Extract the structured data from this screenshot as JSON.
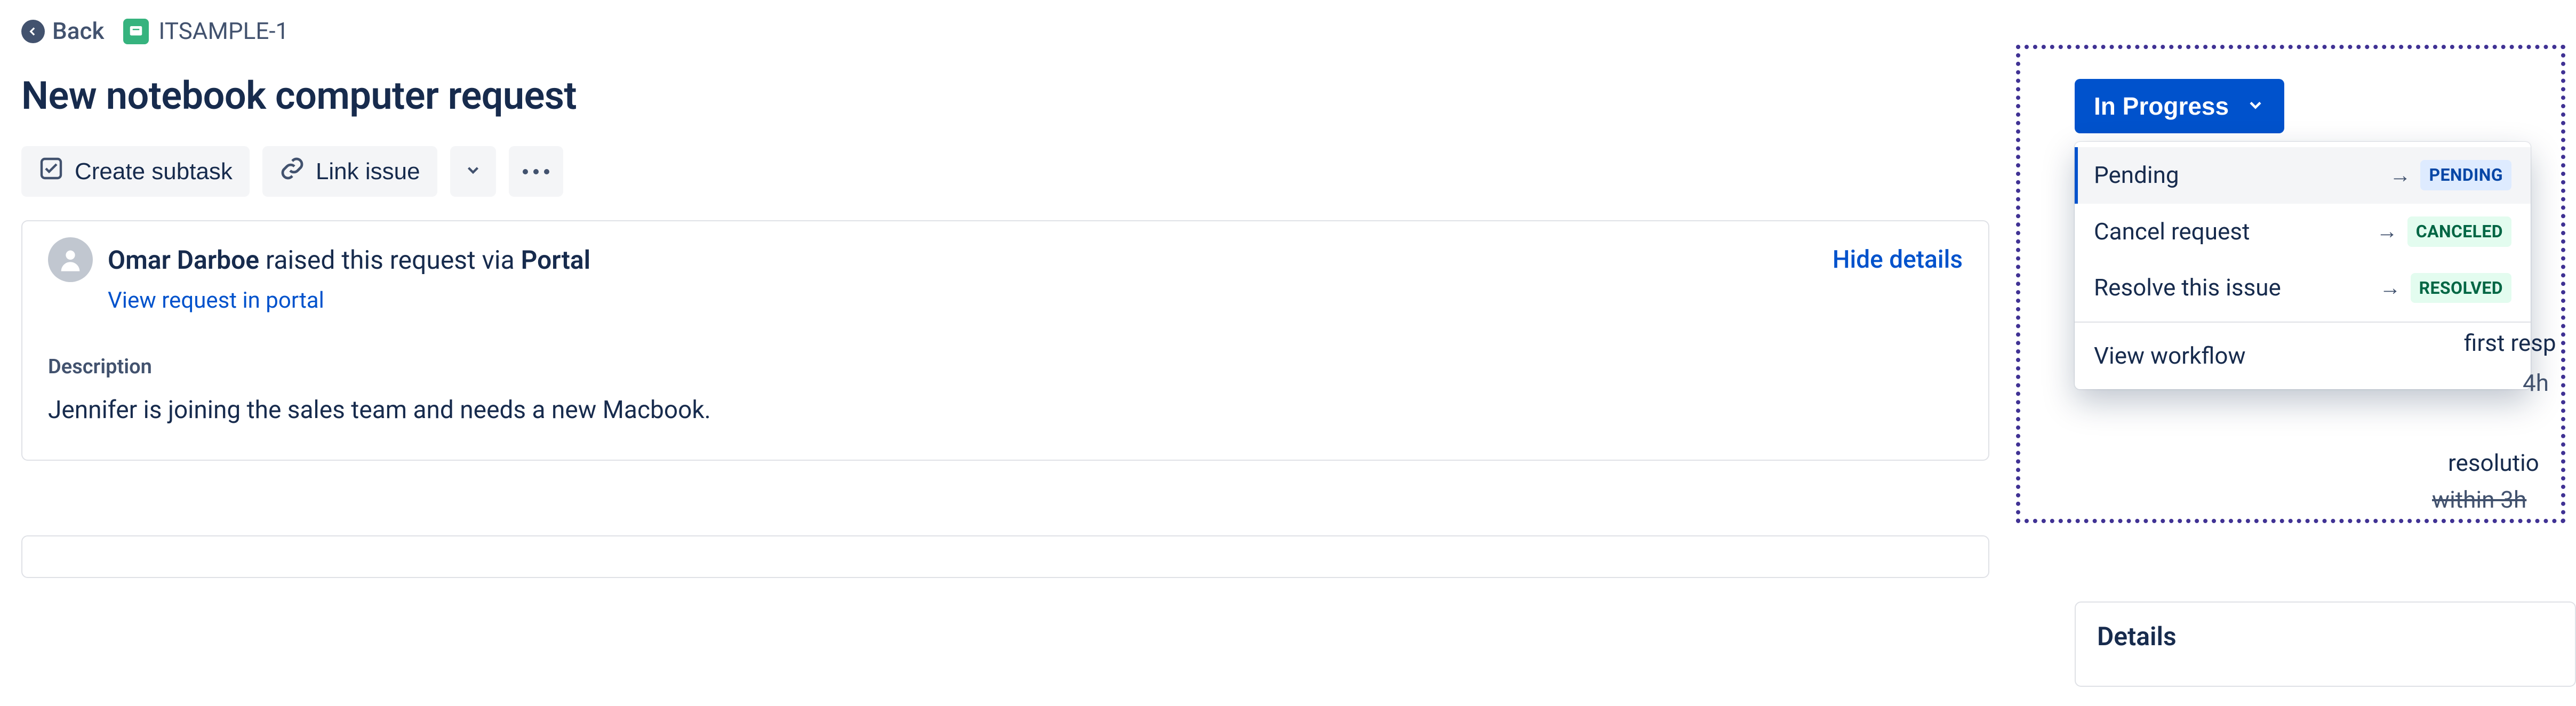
{
  "breadcrumb": {
    "back_label": "Back",
    "key": "ITSAMPLE-1"
  },
  "title": "New notebook computer request",
  "toolbar": {
    "create_subtask": "Create subtask",
    "link_issue": "Link issue"
  },
  "request": {
    "reporter": "Omar Darboe",
    "middle": " raised this request via ",
    "channel": "Portal",
    "hide_details": "Hide details",
    "view_in_portal": "View request in portal"
  },
  "description": {
    "label": "Description",
    "text": "Jennifer is joining the sales team and needs a new Macbook."
  },
  "status": {
    "current": "In Progress",
    "transitions": [
      {
        "label": "Pending",
        "target": "PENDING",
        "color": "blue"
      },
      {
        "label": "Cancel request",
        "target": "CANCELED",
        "color": "green"
      },
      {
        "label": "Resolve this issue",
        "target": "RESOLVED",
        "color": "green"
      }
    ],
    "view_workflow": "View workflow"
  },
  "sla": {
    "first_response": "first resp",
    "first_response_time": "4h",
    "resolution": "resolutio",
    "resolution_time": "within 3h"
  },
  "details": {
    "header": "Details"
  }
}
